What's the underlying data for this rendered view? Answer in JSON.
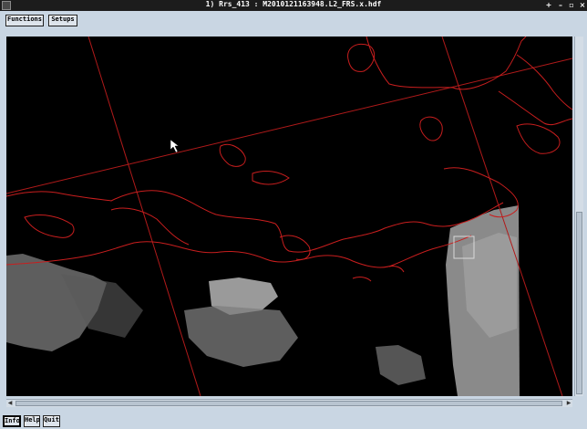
{
  "window": {
    "title": "1) Rrs_413 : M2010121163948.L2_FRS.x.hdf",
    "controls": [
      "pin-icon",
      "minimize-icon",
      "maximize-icon",
      "close-icon"
    ],
    "control_glyphs": {
      "pin": "+",
      "minimize": "–",
      "maximize": "▫",
      "close": "×"
    }
  },
  "toolbar": {
    "functions_label": "Functions",
    "setups_label": "Setups"
  },
  "bottom_bar": {
    "info_label": "Info",
    "help_label": "Help",
    "quit_label": "Quit"
  },
  "image": {
    "background": "#000000",
    "coastline_color": "#c81e1e",
    "grid_line_color": "#b01a1a",
    "data_gray": "#8a8a8a"
  },
  "colors": {
    "window_bg": "#c9d6e3",
    "titlebar_bg": "#1c1c1c"
  }
}
